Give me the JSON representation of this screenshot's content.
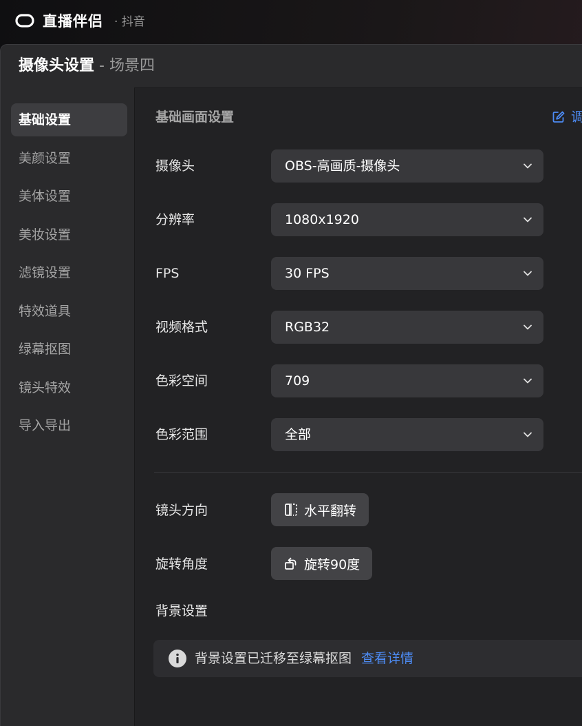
{
  "app": {
    "name": "直播伴侣",
    "platform": "· 抖音"
  },
  "window": {
    "title": "摄像头设置",
    "subtitle": " - 场景四"
  },
  "sidebar": {
    "items": [
      {
        "label": "基础设置",
        "active": true
      },
      {
        "label": "美颜设置",
        "active": false
      },
      {
        "label": "美体设置",
        "active": false
      },
      {
        "label": "美妆设置",
        "active": false
      },
      {
        "label": "滤镜设置",
        "active": false
      },
      {
        "label": "特效道具",
        "active": false
      },
      {
        "label": "绿幕抠图",
        "active": false
      },
      {
        "label": "镜头特效",
        "active": false
      },
      {
        "label": "导入导出",
        "active": false
      }
    ]
  },
  "main": {
    "section_title": "基础画面设置",
    "edit_link": "调",
    "fields": [
      {
        "label": "摄像头",
        "value": "OBS-高画质-摄像头"
      },
      {
        "label": "分辨率",
        "value": "1080x1920"
      },
      {
        "label": "FPS",
        "value": "30 FPS"
      },
      {
        "label": "视频格式",
        "value": "RGB32"
      },
      {
        "label": "色彩空间",
        "value": "709"
      },
      {
        "label": "色彩范围",
        "value": "全部"
      }
    ],
    "lens_direction": {
      "label": "镜头方向",
      "button": "水平翻转"
    },
    "rotation": {
      "label": "旋转角度",
      "button": "旋转90度"
    },
    "background": {
      "label": "背景设置"
    },
    "notice": {
      "text": "背景设置已迁移至绿幕抠图",
      "link": "查看详情"
    }
  },
  "colors": {
    "accent": "#4d8cf5",
    "panel": "#222224",
    "sidebar": "#2a2a2c",
    "control": "#38383b"
  }
}
